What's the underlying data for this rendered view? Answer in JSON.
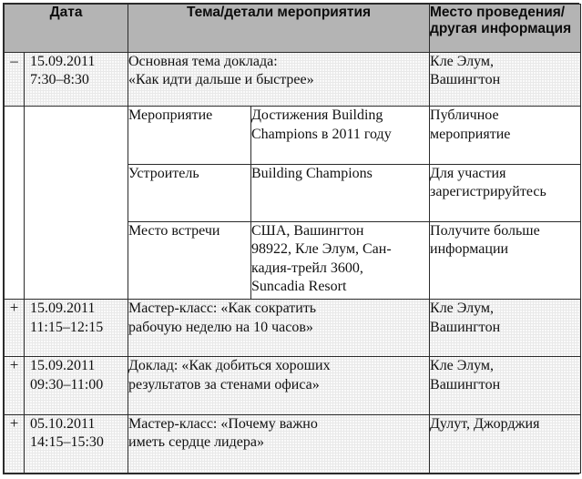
{
  "header": {
    "date": "Дата",
    "topic": "Тема/детали мероприятия",
    "place": "Место проведения/\nдругая информация",
    "place_line1": "Место проведения/",
    "place_line2": "другая информация"
  },
  "icons": {
    "expanded": "–",
    "collapsed": "+"
  },
  "colors": {
    "header_background": "#b4b4b4",
    "row_tint": "#e9e9e9",
    "row_plain": "#ffffff",
    "border": "#2b2b2b",
    "text": "#111111"
  },
  "rows": [
    {
      "state": "expanded",
      "marker": "–",
      "date": "15.09.2011",
      "time": "7:30–8:30",
      "topic_line1": "Основная тема доклада:",
      "topic_line2": "«Как идти дальше и быстрее»",
      "place_line1": "Кле Элум,",
      "place_line2": "Вашингтон",
      "details": [
        {
          "label": "Мероприятие",
          "value_line1": "Достижения Building",
          "value_line2": "Champions в 2011 году",
          "info_line1": "Публичное",
          "info_line2": "мероприятие"
        },
        {
          "label": "Устроитель",
          "value_line1": "Building Champions",
          "value_line2": "",
          "info_line1": "Для участия",
          "info_line2": "зарегистрируйтесь"
        },
        {
          "label": "Место встречи",
          "value_line1": "США, Вашингтон",
          "value_line2": "98922, Кле Элум, Сан-",
          "value_line3": "кадия-трейл 3600,",
          "value_line4": "Suncadia Resort",
          "info_line1": "Получите больше",
          "info_line2": "информации"
        }
      ]
    },
    {
      "state": "collapsed",
      "marker": "+",
      "date": "15.09.2011",
      "time": "11:15–12:15",
      "topic_line1": "Мастер-класс: «Как сократить",
      "topic_line2": "рабочую неделю на 10 часов»",
      "place_line1": "Кле Элум,",
      "place_line2": "Вашингтон"
    },
    {
      "state": "collapsed",
      "marker": "+",
      "date": "15.09.2011",
      "time": "09:30–11:00",
      "topic_line1": "Доклад: «Как добиться хороших",
      "topic_line2": "результатов за стенами офиса»",
      "place_line1": "Кле Элум,",
      "place_line2": "Вашингтон"
    },
    {
      "state": "collapsed",
      "marker": "+",
      "date": "05.10.2011",
      "time": "14:15–15:30",
      "topic_line1": "Мастер-класс: «Почему важно",
      "topic_line2": "иметь сердце лидера»",
      "place_line1": "Дулут, Джорджия",
      "place_line2": ""
    }
  ]
}
